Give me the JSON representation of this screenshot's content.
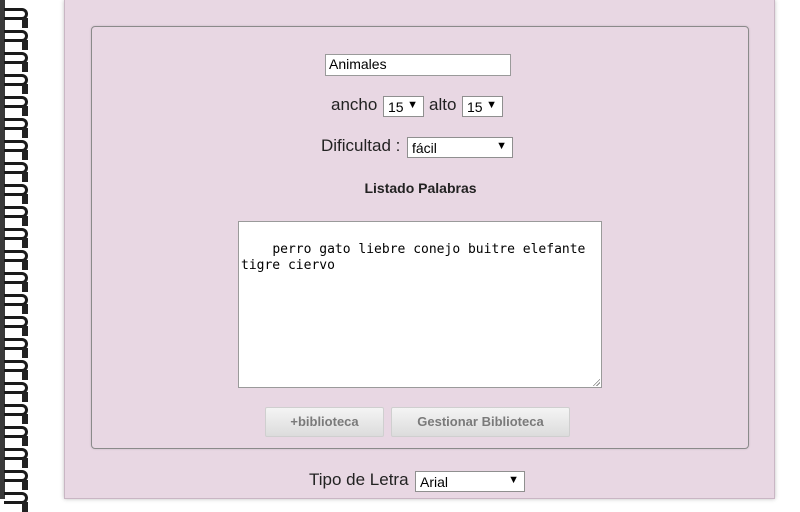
{
  "form": {
    "title_value": "Animales",
    "width_label": "ancho",
    "width_value": "15",
    "height_label": "alto",
    "height_value": "15",
    "difficulty_label": "Dificultad :",
    "difficulty_value": "fácil",
    "words_heading": "Listado Palabras",
    "words_text": "perro gato liebre conejo buitre elefante\ntigre ciervo",
    "add_library_label": "+biblioteca",
    "manage_library_label": "Gestionar Biblioteca",
    "font_label": "Tipo de Letra",
    "font_value": "Arial"
  },
  "icons": {
    "dropdown_arrow": "▼"
  }
}
